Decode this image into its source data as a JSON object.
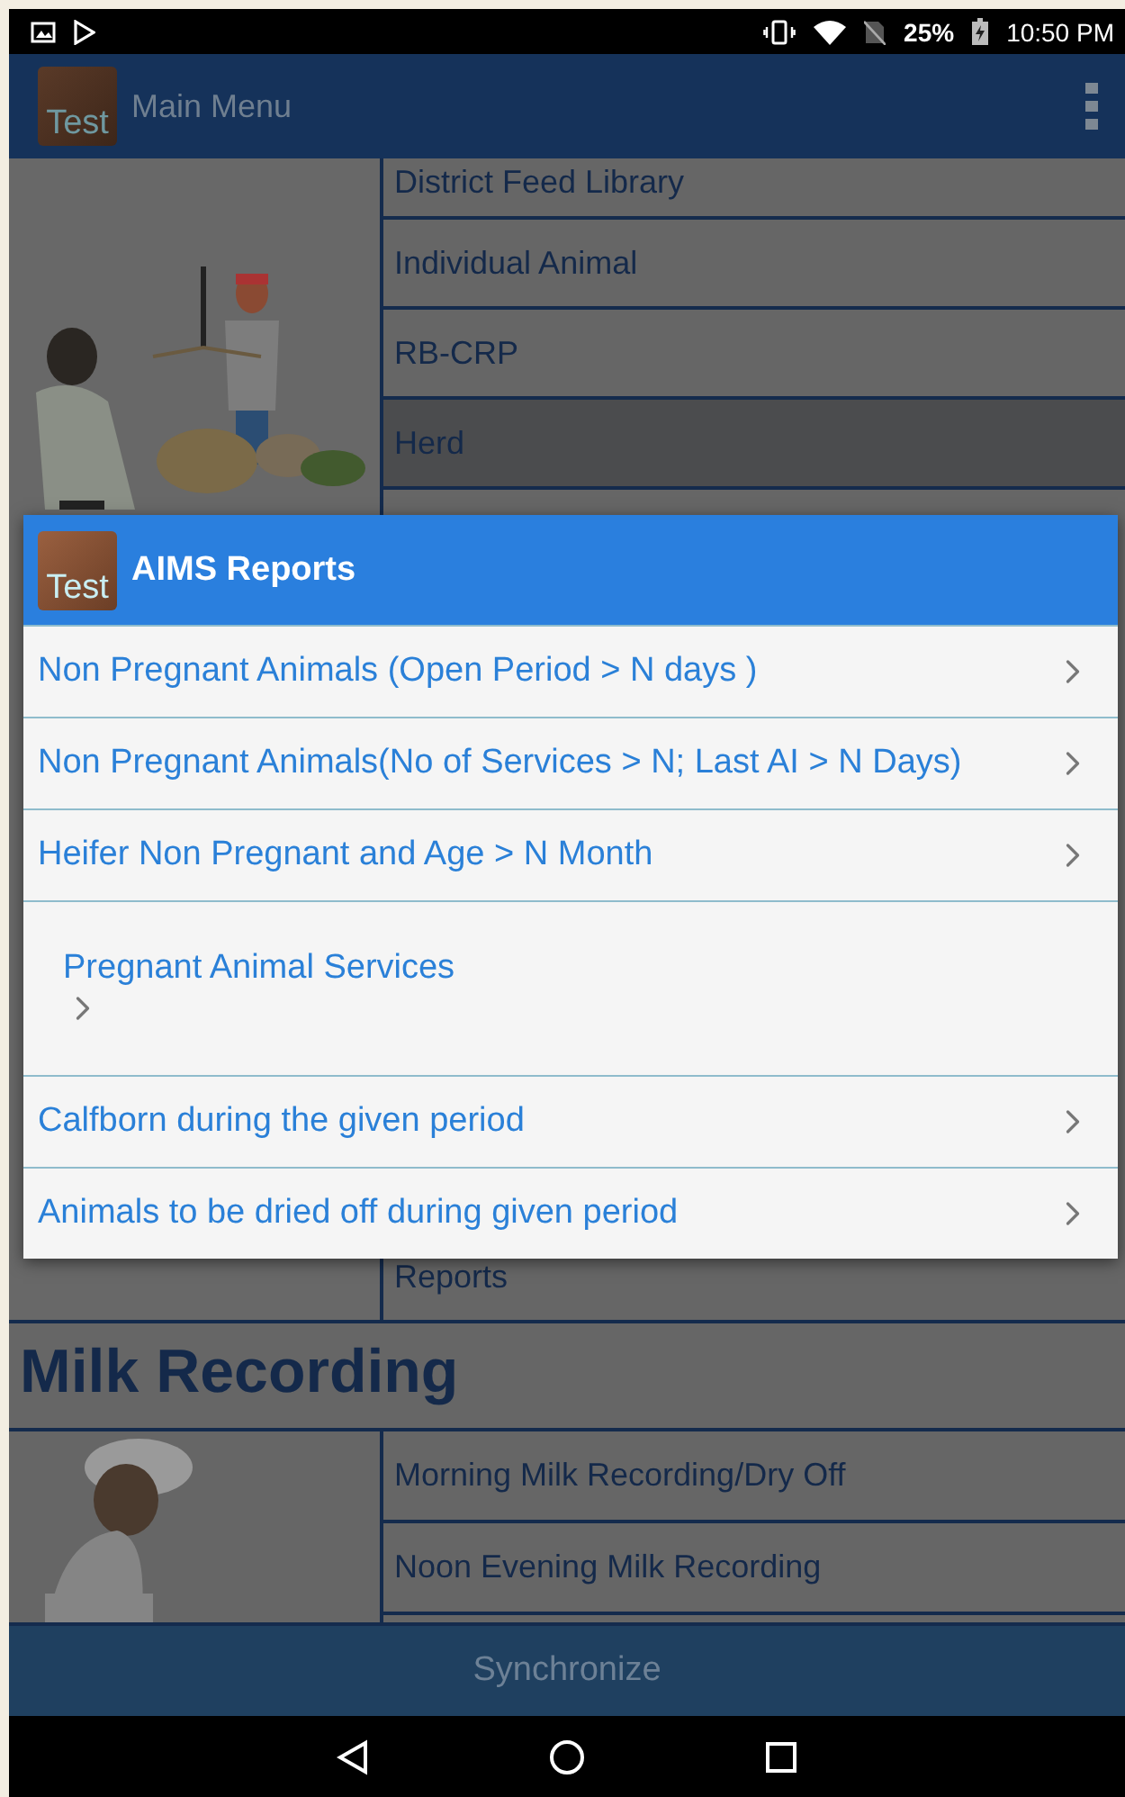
{
  "status_bar": {
    "battery": "25%",
    "time": "10:50 PM"
  },
  "app_bar": {
    "logo_text": "Test",
    "title": "Main Menu"
  },
  "upper_section": {
    "items": [
      {
        "label": "District Feed Library",
        "selected": false
      },
      {
        "label": "Individual Animal",
        "selected": false
      },
      {
        "label": "RB-CRP",
        "selected": false
      },
      {
        "label": "Herd",
        "selected": true
      }
    ],
    "items_below_dialog": [
      {
        "label": "Reports",
        "selected": false
      }
    ]
  },
  "milk_section": {
    "heading": "Milk Recording",
    "items": [
      {
        "label": "Morning Milk Recording/Dry Off",
        "selected": false
      },
      {
        "label": "Noon Evening Milk Recording",
        "selected": false
      }
    ]
  },
  "dialog": {
    "logo_text": "Test",
    "title": "AIMS Reports",
    "items": [
      {
        "label": "Non Pregnant Animals (Open Period > N days )",
        "kind": "inline"
      },
      {
        "label": "Non Pregnant Animals(No of Services > N; Last AI > N Days)",
        "kind": "inline"
      },
      {
        "label": "Heifer Non Pregnant and Age > N Month",
        "kind": "inline"
      },
      {
        "label": "Pregnant Animal Services",
        "kind": "stacked"
      },
      {
        "label": "Calfborn during the given period",
        "kind": "inline"
      },
      {
        "label": "Animals to be dried off during given period",
        "kind": "inline"
      }
    ]
  },
  "footer_button": "Synchronize"
}
